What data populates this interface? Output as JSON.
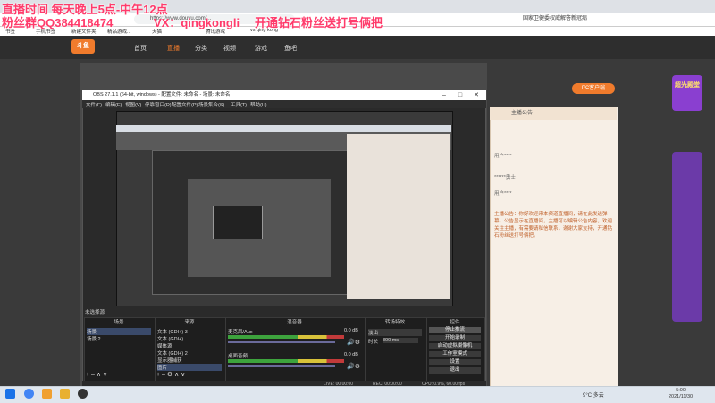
{
  "overlay": {
    "line1": "直播时间 每天晚上5点-中午12点",
    "line2": "粉丝群QQ384418474",
    "line3": "VX：qingkongli",
    "line4": "开通钻石粉丝送打号俩把"
  },
  "browser": {
    "url": "https://www.douyu.com/...",
    "extension_text": "国家卫健委权威解答新冠病"
  },
  "bookmarks": [
    "书签",
    "手机书签",
    "新建文件夹",
    "精品游戏...",
    "天猫",
    "腾讯游戏",
    "vs qing kong"
  ],
  "site": {
    "logo": "斗鱼",
    "nav": [
      "首页",
      "直播",
      "分类",
      "视频",
      "游戏",
      "鱼吧"
    ],
    "pc_button": "PC客户端",
    "right_promo": "超光殿堂"
  },
  "chat": {
    "header": "主播公告",
    "users": [
      "用户****",
      "******勇士",
      "用户****"
    ],
    "announcement": "主播公告：你好欢迎来本频道直播间，请在此发送弹幕。公告显示在直播间，主播可以编辑公告内容，欢迎关注主播，有需要请私信联系，谢谢大家支持，开通钻石粉丝送打号俩把。"
  },
  "obs": {
    "title": "OBS 27.1.1 (64-bit, windows) - 配置文件: 未命名 - 场景: 未命名",
    "menu": [
      "文件(F)",
      "编辑(E)",
      "视图(V)",
      "停靠窗口(D)",
      "配置文件(P)",
      "场景集合(S)",
      "工具(T)",
      "帮助(H)"
    ],
    "scene_status": "未选择源",
    "docks": {
      "scenes": "场景",
      "sources": "来源",
      "mixer": "混音器",
      "transitions": "转场特效",
      "controls": "控件"
    },
    "scenes": [
      "场景",
      "场景 2"
    ],
    "sources": [
      "文本 (GDI+) 3",
      "文本 (GDI+)",
      "媒体源",
      "文本 (GDI+) 2",
      "显示器捕获",
      "图片"
    ],
    "mixer": [
      {
        "name": "麦克风/Aux",
        "level": "0.0 dB"
      },
      {
        "name": "桌面音频",
        "level": "0.0 dB"
      }
    ],
    "transition": {
      "type": "淡出",
      "duration_label": "时长",
      "duration": "300 ms"
    },
    "controls": [
      "停止推流",
      "开始录制",
      "启动虚拟摄像机",
      "工作室模式",
      "设置",
      "退出"
    ],
    "status": {
      "live": "LIVE: 00:00:00",
      "rec": "REC: 00:00:00",
      "cpu": "CPU: 0.9%, 60.00 fps"
    }
  },
  "taskbar": {
    "weather": "9°C 多云",
    "time": "5:00",
    "date": "2021/11/30"
  }
}
